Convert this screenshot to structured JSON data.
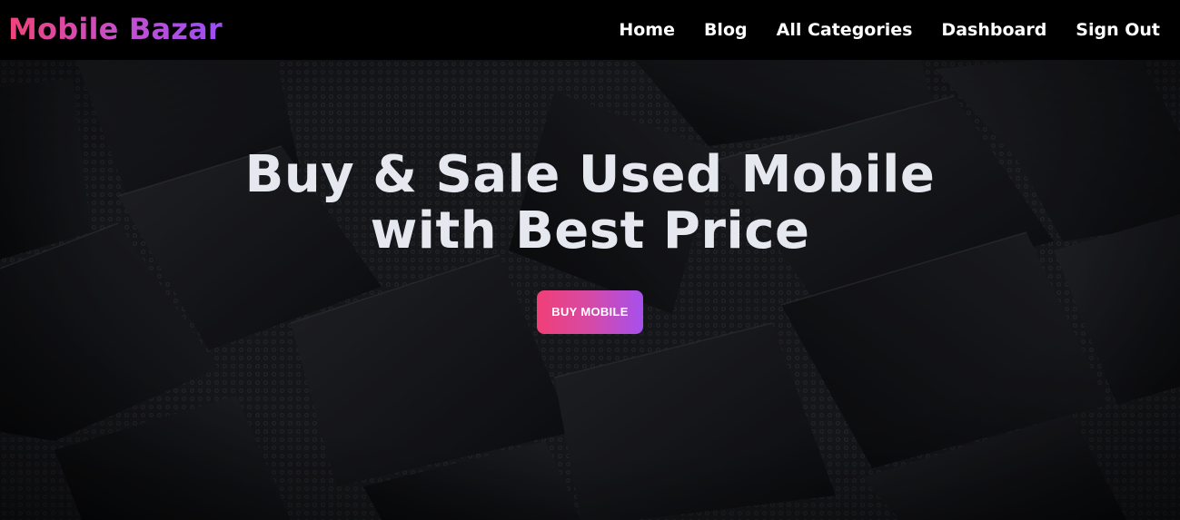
{
  "header": {
    "brand": "Mobile Bazar",
    "nav": [
      {
        "label": "Home"
      },
      {
        "label": "Blog"
      },
      {
        "label": "All Categories"
      },
      {
        "label": "Dashboard"
      },
      {
        "label": "Sign Out"
      }
    ]
  },
  "hero": {
    "title": "Buy & Sale Used Mobile with Best Price",
    "cta_label": "BUY MOBILE"
  },
  "colors": {
    "brand_gradient_start": "#f0437a",
    "brand_gradient_end": "#9b4ff3",
    "hero_text": "#e5e8ef",
    "navbar_bg": "#000000"
  }
}
